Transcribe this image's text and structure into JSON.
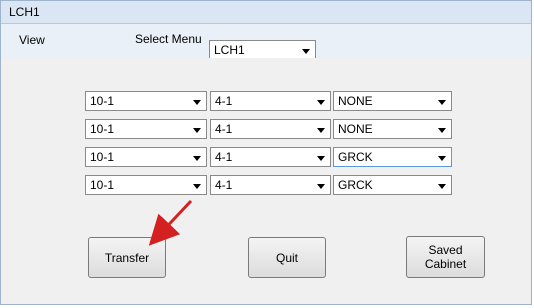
{
  "window": {
    "title": "LCH1"
  },
  "menubar": {
    "view_label": "View",
    "select_menu_label": "Select Menu",
    "select_menu_value": "LCH1"
  },
  "rows": [
    {
      "col1": "10-1",
      "col2": "4-1",
      "col3": "NONE"
    },
    {
      "col1": "10-1",
      "col2": "4-1",
      "col3": "NONE"
    },
    {
      "col1": "10-1",
      "col2": "4-1",
      "col3": "GRCK"
    },
    {
      "col1": "10-1",
      "col2": "4-1",
      "col3": "GRCK"
    }
  ],
  "buttons": {
    "transfer": "Transfer",
    "quit": "Quit",
    "saved_cabinet_line1": "Saved",
    "saved_cabinet_line2": "Cabinet"
  },
  "annotation": {
    "color": "#d42020",
    "icon": "red-arrow-icon"
  }
}
